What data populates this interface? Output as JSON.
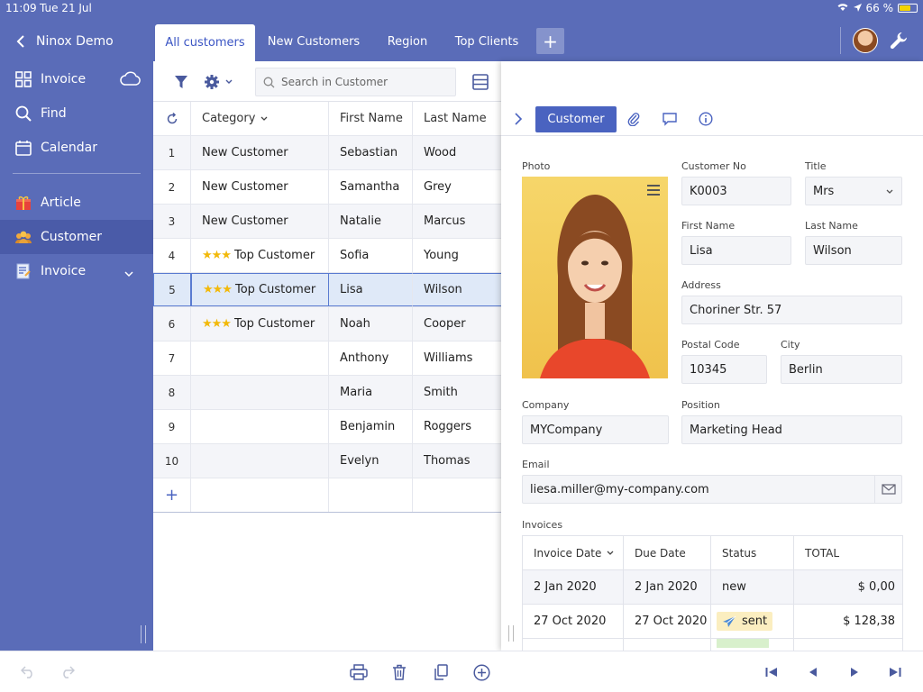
{
  "status": {
    "time": "11:09",
    "date": "Tue 21 Jul",
    "battery": "66 %"
  },
  "sidebar": {
    "back_label": "Ninox Demo",
    "items": [
      {
        "label": "Invoice",
        "icon": "grid-icon"
      },
      {
        "label": "Find",
        "icon": "search-icon"
      },
      {
        "label": "Calendar",
        "icon": "calendar-icon"
      },
      {
        "label": "Article",
        "icon": "gift-icon"
      },
      {
        "label": "Customer",
        "icon": "customers-icon",
        "active": true
      },
      {
        "label": "Invoice",
        "icon": "invoice-icon"
      }
    ]
  },
  "tabs": [
    {
      "label": "All customers",
      "active": true
    },
    {
      "label": "New Customers"
    },
    {
      "label": "Region"
    },
    {
      "label": "Top Clients"
    }
  ],
  "toolbar": {
    "search_placeholder": "Search in Customer"
  },
  "grid": {
    "columns": [
      "Category",
      "First Name",
      "Last Name"
    ],
    "rows": [
      {
        "no": "1",
        "category": "New Customer",
        "stars": "",
        "first": "Sebastian",
        "last": "Wood"
      },
      {
        "no": "2",
        "category": "New Customer",
        "stars": "",
        "first": "Samantha",
        "last": "Grey"
      },
      {
        "no": "3",
        "category": "New Customer",
        "stars": "",
        "first": "Natalie",
        "last": "Marcus"
      },
      {
        "no": "4",
        "category": "Top Customer",
        "stars": "★★★",
        "first": "Sofia",
        "last": "Young"
      },
      {
        "no": "5",
        "category": "Top Customer",
        "stars": "★★★",
        "first": "Lisa",
        "last": "Wilson"
      },
      {
        "no": "6",
        "category": "Top Customer",
        "stars": "★★★",
        "first": "Noah",
        "last": "Cooper"
      },
      {
        "no": "7",
        "category": "",
        "stars": "",
        "first": "Anthony",
        "last": "Williams"
      },
      {
        "no": "8",
        "category": "",
        "stars": "",
        "first": "Maria",
        "last": "Smith"
      },
      {
        "no": "9",
        "category": "",
        "stars": "",
        "first": "Benjamin",
        "last": "Roggers"
      },
      {
        "no": "10",
        "category": "",
        "stars": "",
        "first": "Evelyn",
        "last": "Thomas"
      }
    ],
    "add_label": "+"
  },
  "detail": {
    "tab_label": "Customer",
    "labels": {
      "photo": "Photo",
      "customer_no": "Customer No",
      "title": "Title",
      "first_name": "First Name",
      "last_name": "Last Name",
      "address": "Address",
      "postal_code": "Postal Code",
      "city": "City",
      "company": "Company",
      "position": "Position",
      "email": "Email",
      "invoices": "Invoices"
    },
    "values": {
      "customer_no": "K0003",
      "title": "Mrs",
      "first_name": "Lisa",
      "last_name": "Wilson",
      "address": "Choriner Str. 57",
      "postal_code": "10345",
      "city": "Berlin",
      "company": "MYCompany",
      "position": "Marketing Head",
      "email": "liesa.miller@my-company.com"
    },
    "invoices": {
      "columns": [
        "Invoice Date",
        "Due Date",
        "Status",
        "TOTAL"
      ],
      "rows": [
        {
          "date": "2 Jan 2020",
          "due": "2 Jan 2020",
          "status": "new",
          "total": "$ 0,00"
        },
        {
          "date": "27 Oct 2020",
          "due": "27 Oct 2020",
          "status": "sent",
          "total": "$ 128,38"
        }
      ]
    }
  },
  "colors": {
    "accent": "#5a6cb8",
    "button": "#4a63c0",
    "selected_row": "#dfe9f8",
    "star": "#f2b90a"
  }
}
